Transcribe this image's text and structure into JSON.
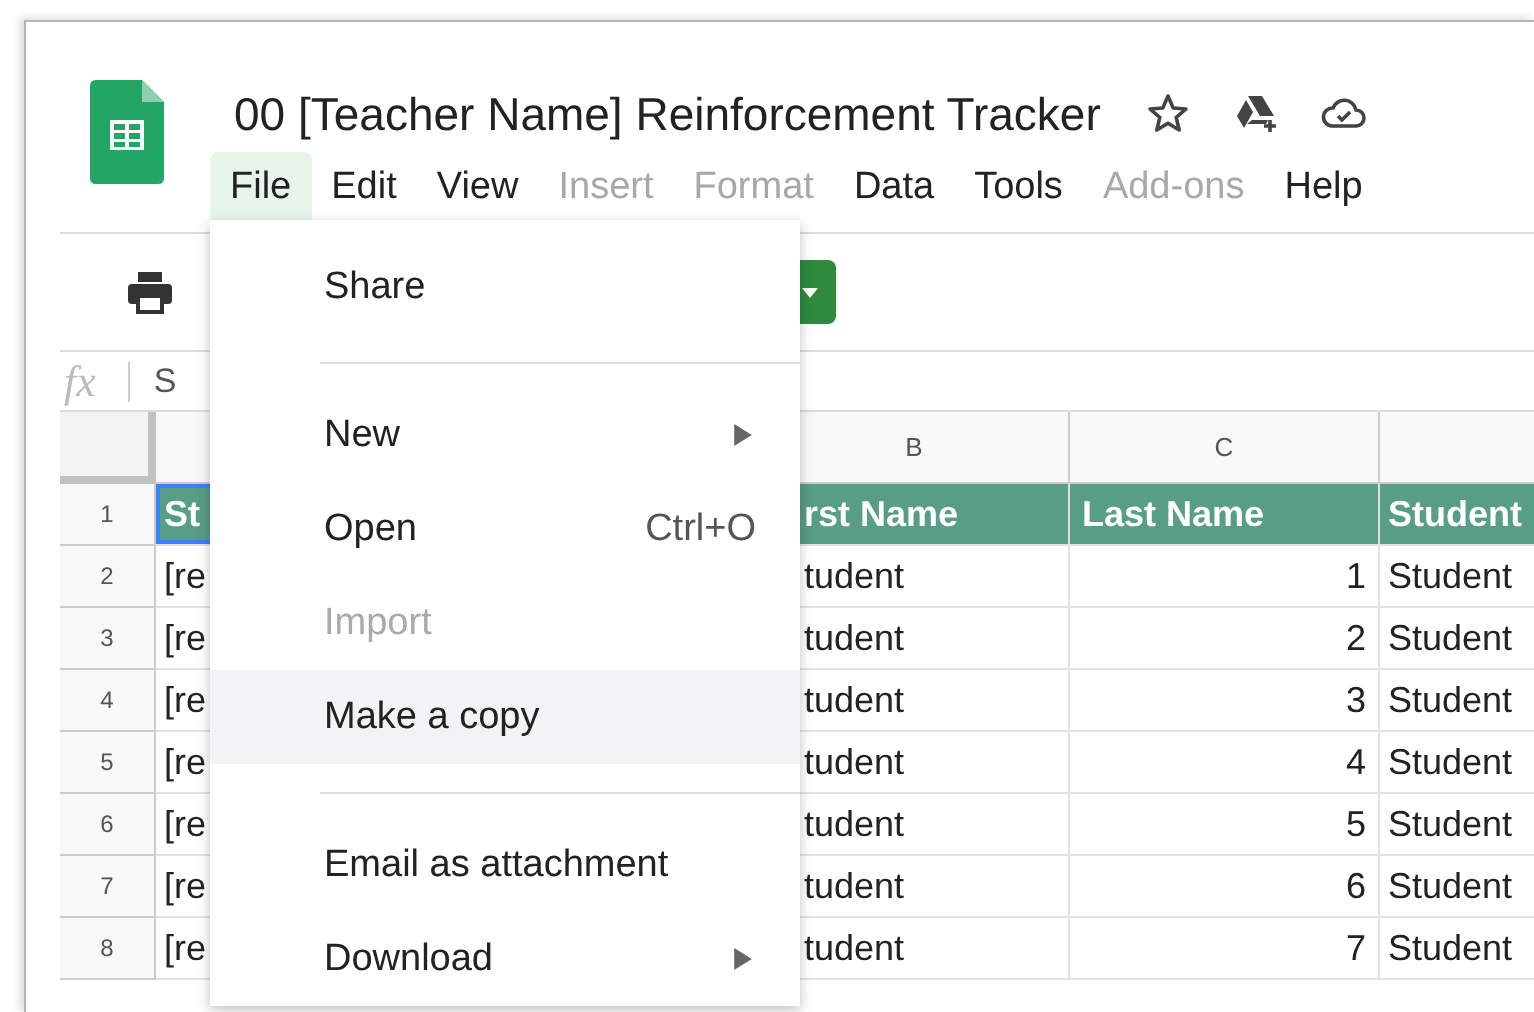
{
  "document": {
    "title": "00 [Teacher Name] Reinforcement Tracker"
  },
  "menu_bar": [
    {
      "label": "File",
      "selected": true,
      "disabled": false
    },
    {
      "label": "Edit",
      "selected": false,
      "disabled": false
    },
    {
      "label": "View",
      "selected": false,
      "disabled": false
    },
    {
      "label": "Insert",
      "selected": false,
      "disabled": true
    },
    {
      "label": "Format",
      "selected": false,
      "disabled": true
    },
    {
      "label": "Data",
      "selected": false,
      "disabled": false
    },
    {
      "label": "Tools",
      "selected": false,
      "disabled": false
    },
    {
      "label": "Add-ons",
      "selected": false,
      "disabled": true
    },
    {
      "label": "Help",
      "selected": false,
      "disabled": false
    }
  ],
  "formula_bar": {
    "label": "fx",
    "value": "S"
  },
  "sheet": {
    "column_headers": [
      "B",
      "C"
    ],
    "header_row": {
      "number": "1",
      "cells": [
        {
          "text": "St",
          "selected": true
        },
        {
          "text": "rst Name",
          "selected": false
        },
        {
          "text": "Last Name",
          "selected": false
        },
        {
          "text": "Student",
          "selected": false
        }
      ]
    },
    "rows": [
      {
        "number": "2",
        "cells": [
          "[re",
          "tudent",
          "1",
          "Student"
        ]
      },
      {
        "number": "3",
        "cells": [
          "[re",
          "tudent",
          "2",
          "Student"
        ]
      },
      {
        "number": "4",
        "cells": [
          "[re",
          "tudent",
          "3",
          "Student"
        ]
      },
      {
        "number": "5",
        "cells": [
          "[re",
          "tudent",
          "4",
          "Student"
        ]
      },
      {
        "number": "6",
        "cells": [
          "[re",
          "tudent",
          "5",
          "Student"
        ]
      },
      {
        "number": "7",
        "cells": [
          "[re",
          "tudent",
          "6",
          "Student"
        ]
      },
      {
        "number": "8",
        "cells": [
          "[re",
          "tudent",
          "7",
          "Student"
        ]
      }
    ]
  },
  "file_menu": {
    "items": [
      {
        "kind": "item",
        "label": "Share",
        "disabled": false,
        "highlighted": false,
        "submenu": false
      },
      {
        "kind": "divider"
      },
      {
        "kind": "item",
        "label": "New",
        "disabled": false,
        "highlighted": false,
        "submenu": true
      },
      {
        "kind": "item",
        "label": "Open",
        "shortcut": "Ctrl+O",
        "disabled": false,
        "highlighted": false,
        "submenu": false
      },
      {
        "kind": "item",
        "label": "Import",
        "disabled": true,
        "highlighted": false,
        "submenu": false
      },
      {
        "kind": "item",
        "label": "Make a copy",
        "disabled": false,
        "highlighted": true,
        "submenu": false
      },
      {
        "kind": "divider"
      },
      {
        "kind": "item",
        "label": "Email as attachment",
        "disabled": false,
        "highlighted": false,
        "submenu": false
      },
      {
        "kind": "item",
        "label": "Download",
        "disabled": false,
        "highlighted": false,
        "submenu": true
      }
    ]
  }
}
